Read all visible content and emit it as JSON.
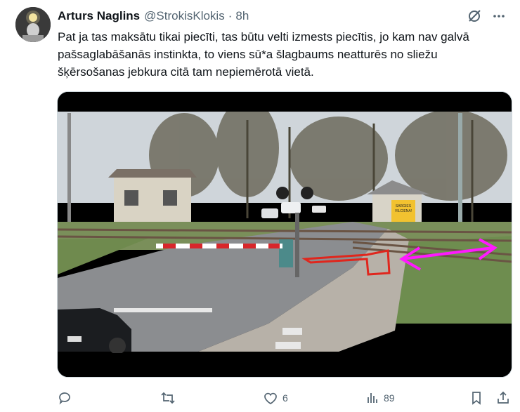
{
  "author": {
    "name": "Arturs Naglins",
    "handle": "@StrokisKlokis",
    "separator": "·",
    "time": "8h"
  },
  "tweet": {
    "text": "Pat ja tas maksātu tikai piecīti, tas būtu velti izmests piecītis, jo kam nav galvā pašsaglabāšanās instinkta, to viens sū*a šlagbaums neatturēs no sliežu šķērsošanas jebkura citā tam nepiemērotā vietā."
  },
  "media": {
    "sign_line1": "SARGIES",
    "sign_line2": "VILCIENA!",
    "annotation_colors": {
      "red_outline": "#e0261d",
      "magenta_arrow": "#ff19ff"
    }
  },
  "actions": {
    "reply_count": "",
    "retweet_count": "",
    "like_count": "6",
    "view_count": "89"
  },
  "icons": [
    "grok-icon",
    "more-icon",
    "reply-icon",
    "retweet-icon",
    "like-icon",
    "views-icon",
    "bookmark-icon",
    "share-icon"
  ]
}
